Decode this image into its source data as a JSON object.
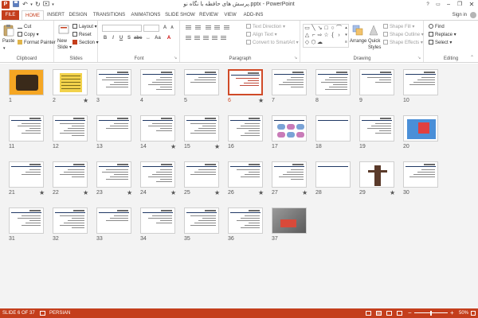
{
  "window": {
    "title": "پرسش های حافظه با نگاه نو.pptx - PowerPoint",
    "minimize": "−",
    "restore": "❐",
    "close": "✕",
    "help": "?"
  },
  "quick_access": {
    "app_logo": "P",
    "save": "💾",
    "undo": "↶",
    "redo": "↻",
    "customize": "▾"
  },
  "ribbon_tabs": [
    "FILE",
    "HOME",
    "INSERT",
    "DESIGN",
    "TRANSITIONS",
    "ANIMATIONS",
    "SLIDE SHOW",
    "REVIEW",
    "VIEW",
    "ADD-INS"
  ],
  "active_tab": "HOME",
  "signin": "Sign in",
  "clipboard": {
    "paste": "Paste",
    "cut": "Cut",
    "copy": "Copy",
    "format_painter": "Format Painter",
    "label": "Clipboard"
  },
  "slides_group": {
    "new_slide": "New",
    "new_slide_2": "Slide",
    "layout": "Layout",
    "reset": "Reset",
    "section": "Section",
    "label": "Slides"
  },
  "font_group": {
    "bold": "B",
    "italic": "I",
    "underline": "U",
    "strike": "S",
    "label": "Font"
  },
  "paragraph_group": {
    "text_direction": "Text Direction",
    "align_text": "Align Text",
    "convert_smartart": "Convert to SmartArt",
    "label": "Paragraph"
  },
  "drawing_group": {
    "arrange": "Arrange",
    "quick_styles": "Quick",
    "quick_styles_2": "Styles",
    "shape_fill": "Shape Fill",
    "shape_outline": "Shape Outline",
    "shape_effects": "Shape Effects",
    "label": "Drawing"
  },
  "editing_group": {
    "find": "Find",
    "replace": "Replace",
    "select": "Select",
    "label": "Editing"
  },
  "slides": [
    {
      "n": "1",
      "star": false,
      "kind": "image-orange"
    },
    {
      "n": "2",
      "star": true,
      "kind": "image-yellow"
    },
    {
      "n": "3",
      "star": false,
      "kind": "text"
    },
    {
      "n": "4",
      "star": false,
      "kind": "text"
    },
    {
      "n": "5",
      "star": false,
      "kind": "text"
    },
    {
      "n": "6",
      "star": true,
      "kind": "text-red",
      "selected": true
    },
    {
      "n": "7",
      "star": false,
      "kind": "text"
    },
    {
      "n": "8",
      "star": false,
      "kind": "text"
    },
    {
      "n": "9",
      "star": false,
      "kind": "text"
    },
    {
      "n": "10",
      "star": false,
      "kind": "text"
    },
    {
      "n": "11",
      "star": false,
      "kind": "text"
    },
    {
      "n": "12",
      "star": false,
      "kind": "text"
    },
    {
      "n": "13",
      "star": false,
      "kind": "text"
    },
    {
      "n": "14",
      "star": true,
      "kind": "text"
    },
    {
      "n": "15",
      "star": true,
      "kind": "text"
    },
    {
      "n": "16",
      "star": false,
      "kind": "text"
    },
    {
      "n": "17",
      "star": false,
      "kind": "diagram"
    },
    {
      "n": "18",
      "star": false,
      "kind": "blank"
    },
    {
      "n": "19",
      "star": false,
      "kind": "text"
    },
    {
      "n": "20",
      "star": false,
      "kind": "image-blue"
    },
    {
      "n": "21",
      "star": true,
      "kind": "text"
    },
    {
      "n": "22",
      "star": true,
      "kind": "text"
    },
    {
      "n": "23",
      "star": true,
      "kind": "text"
    },
    {
      "n": "24",
      "star": true,
      "kind": "text"
    },
    {
      "n": "25",
      "star": true,
      "kind": "text"
    },
    {
      "n": "26",
      "star": true,
      "kind": "text"
    },
    {
      "n": "27",
      "star": true,
      "kind": "text"
    },
    {
      "n": "28",
      "star": false,
      "kind": "blank"
    },
    {
      "n": "29",
      "star": true,
      "kind": "image-figure"
    },
    {
      "n": "30",
      "star": false,
      "kind": "text"
    },
    {
      "n": "31",
      "star": false,
      "kind": "text"
    },
    {
      "n": "32",
      "star": false,
      "kind": "text"
    },
    {
      "n": "33",
      "star": false,
      "kind": "text"
    },
    {
      "n": "34",
      "star": false,
      "kind": "text"
    },
    {
      "n": "35",
      "star": false,
      "kind": "text"
    },
    {
      "n": "36",
      "star": false,
      "kind": "text"
    },
    {
      "n": "37",
      "star": false,
      "kind": "photo"
    }
  ],
  "status": {
    "slide_of": "SLIDE 6 OF 37",
    "language": "PERSIAN",
    "zoom": "50%",
    "minus": "−",
    "plus": "+"
  },
  "colors": {
    "accent": "#c43e1c",
    "selected_border": "#d04a27",
    "slide_header": "#1f3864"
  }
}
